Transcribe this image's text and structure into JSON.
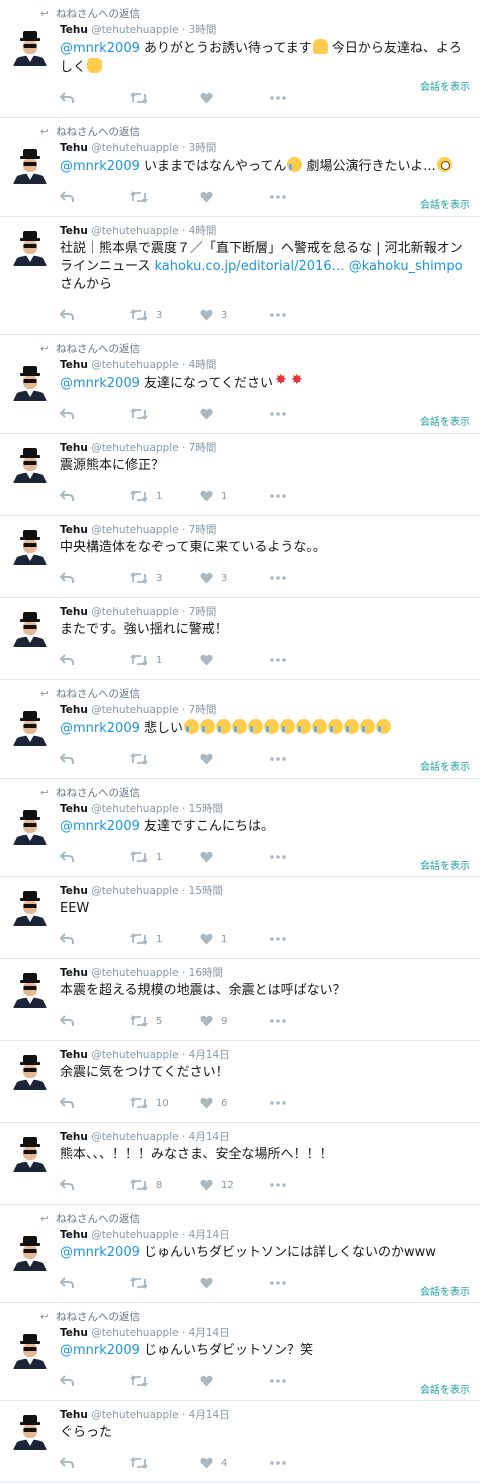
{
  "labels": {
    "reply_context": "ねねさんへの返信",
    "show_conversation": "会話を表示",
    "name": "Tehu",
    "handle": "@tehutehuapple",
    "separator": "·"
  },
  "tweets": [
    {
      "reply": true,
      "time": "3時間",
      "mention": "@mnrk2009",
      "text": "ありがとうお誘い待ってます",
      "emoji1": "pray",
      "text2": " 今日から友達ね、よろしく",
      "emoji2": "hand",
      "retweets": "",
      "likes": "",
      "convo": true,
      "lines": 2
    },
    {
      "reply": true,
      "time": "3時間",
      "mention": "@mnrk2009",
      "text": "いままではなんやってん",
      "emoji1": "cry",
      "text2": " 劇場公演行きたいよ...",
      "emoji2": "flush",
      "retweets": "",
      "likes": "",
      "convo": true,
      "lines": 1
    },
    {
      "reply": false,
      "time": "4時間",
      "mention": "",
      "text": "社説｜熊本県で震度７／「直下断層」へ警戒を怠るな | 河北新報オンラインニュース ",
      "link": "kahoku.co.jp/editorial/2016… @kahoku_shimpo",
      "text2": "さんから",
      "retweets": "3",
      "likes": "3",
      "convo": false,
      "lines": 3
    },
    {
      "reply": true,
      "time": "4時間",
      "mention": "@mnrk2009",
      "text": "友達になってください",
      "emoji1": "anger",
      "emoji2": "anger",
      "retweets": "",
      "likes": "",
      "convo": true,
      "lines": 1
    },
    {
      "reply": false,
      "time": "7時間",
      "mention": "",
      "text": "震源熊本に修正？",
      "retweets": "1",
      "likes": "1",
      "convo": false,
      "lines": 1
    },
    {
      "reply": false,
      "time": "7時間",
      "mention": "",
      "text": "中央構造体をなぞって東に来ているような。。",
      "retweets": "3",
      "likes": "3",
      "convo": false,
      "lines": 1
    },
    {
      "reply": false,
      "time": "7時間",
      "mention": "",
      "text": "またです。強い揺れに警戒！",
      "retweets": "1",
      "likes": "",
      "convo": false,
      "lines": 1
    },
    {
      "reply": true,
      "time": "7時間",
      "mention": "@mnrk2009",
      "text": "悲しい",
      "emoji_repeat": 13,
      "retweets": "",
      "likes": "",
      "convo": true,
      "lines": 1
    },
    {
      "reply": true,
      "time": "15時間",
      "mention": "@mnrk2009",
      "text": "友達ですこんにちは。",
      "retweets": "1",
      "likes": "",
      "convo": true,
      "lines": 1
    },
    {
      "reply": false,
      "time": "15時間",
      "mention": "",
      "text": "EEW",
      "retweets": "1",
      "likes": "1",
      "convo": false,
      "lines": 1
    },
    {
      "reply": false,
      "time": "16時間",
      "mention": "",
      "text": "本震を超える規模の地震は、余震とは呼ばない？",
      "retweets": "5",
      "likes": "9",
      "convo": false,
      "lines": 1
    },
    {
      "reply": false,
      "time": "4月14日",
      "mention": "",
      "text": "余震に気をつけてください！",
      "retweets": "10",
      "likes": "6",
      "convo": false,
      "lines": 1
    },
    {
      "reply": false,
      "time": "4月14日",
      "mention": "",
      "text": "熊本、、、！！！みなさま、安全な場所へ！！！",
      "retweets": "8",
      "likes": "12",
      "convo": false,
      "lines": 1
    },
    {
      "reply": true,
      "time": "4月14日",
      "mention": "@mnrk2009",
      "text": "じゅんいちダビットソンには詳しくないのかwww",
      "retweets": "",
      "likes": "",
      "convo": true,
      "lines": 1
    },
    {
      "reply": true,
      "time": "4月14日",
      "mention": "@mnrk2009",
      "text": "じゅんいちダビットソン？笑",
      "retweets": "",
      "likes": "",
      "convo": true,
      "lines": 1
    },
    {
      "reply": false,
      "time": "4月14日",
      "mention": "",
      "text": "ぐらった",
      "retweets": "",
      "likes": "4",
      "convo": false,
      "lines": 1
    }
  ]
}
